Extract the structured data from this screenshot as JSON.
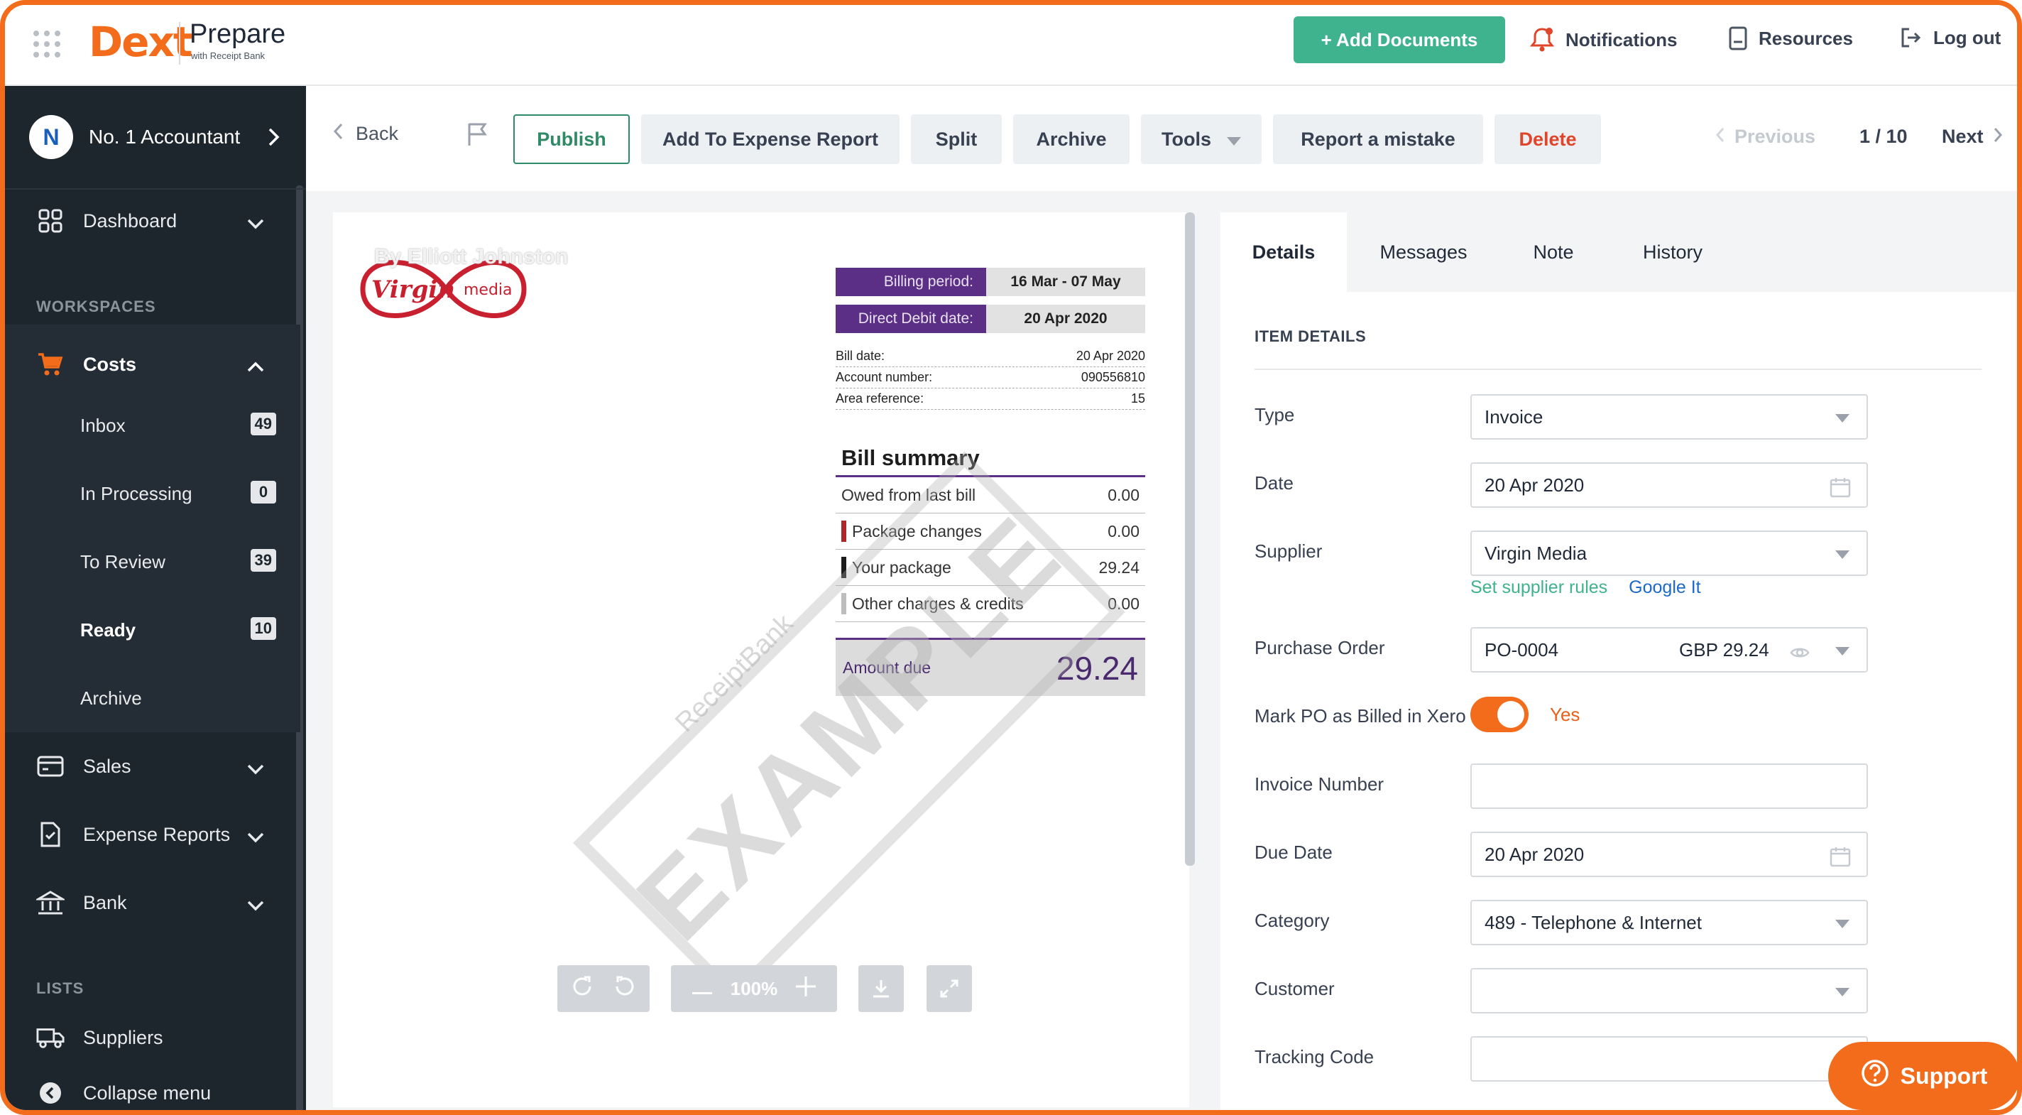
{
  "app": {
    "logo": "Dext",
    "product": "Prepare",
    "product_sub": "with Receipt Bank"
  },
  "topnav": {
    "add_documents": "+ Add Documents",
    "notifications": "Notifications",
    "resources": "Resources",
    "logout": "Log out"
  },
  "sidebar": {
    "account": {
      "initial": "N",
      "name": "No. 1 Accountant"
    },
    "dashboard": "Dashboard",
    "workspaces_heading": "WORKSPACES",
    "costs": "Costs",
    "costs_items": [
      {
        "label": "Inbox",
        "count": "49"
      },
      {
        "label": "In Processing",
        "count": "0"
      },
      {
        "label": "To Review",
        "count": "39"
      },
      {
        "label": "Ready",
        "count": "10"
      },
      {
        "label": "Archive",
        "count": ""
      }
    ],
    "sales": "Sales",
    "expense_reports": "Expense Reports",
    "bank": "Bank",
    "lists_heading": "LISTS",
    "suppliers": "Suppliers",
    "collapse": "Collapse menu"
  },
  "toolbar": {
    "back": "Back",
    "publish": "Publish",
    "add_to_expense": "Add To Expense Report",
    "split": "Split",
    "archive": "Archive",
    "tools": "Tools",
    "report_mistake": "Report a mistake",
    "delete": "Delete",
    "previous": "Previous",
    "page": "1 / 10",
    "next": "Next"
  },
  "document": {
    "uploader": "By Elliott Johnston",
    "brand": "Virgin media",
    "billing_period_label": "Billing period:",
    "billing_period": "16 Mar - 07 May",
    "dd_label": "Direct Debit date:",
    "dd_date": "20 Apr 2020",
    "info": [
      {
        "label": "Bill date:",
        "value": "20 Apr 2020"
      },
      {
        "label": "Account number:",
        "value": "090556810"
      },
      {
        "label": "Area reference:",
        "value": "15"
      }
    ],
    "summary_title": "Bill summary",
    "summary": [
      {
        "label": "Owed from last bill",
        "value": "0.00",
        "marker": ""
      },
      {
        "label": "Package changes",
        "value": "0.00",
        "marker": "#b0242c"
      },
      {
        "label": "Your package",
        "value": "29.24",
        "marker": "#1d1d1d"
      },
      {
        "label": "Other charges & credits",
        "value": "0.00",
        "marker": "#bdbdbd"
      }
    ],
    "amount_label": "Amount due",
    "amount": "29.24",
    "watermark": "EXAMPLE",
    "watermark_sub": "ReceiptBank",
    "zoom": "100%"
  },
  "details": {
    "tabs": [
      "Details",
      "Messages",
      "Note",
      "History"
    ],
    "section": "ITEM DETAILS",
    "fields": {
      "type": {
        "label": "Type",
        "value": "Invoice"
      },
      "date": {
        "label": "Date",
        "value": "20 Apr 2020"
      },
      "supplier": {
        "label": "Supplier",
        "value": "Virgin Media"
      },
      "supplier_rules": "Set supplier rules",
      "google_it": "Google It",
      "po": {
        "label": "Purchase Order",
        "value": "PO-0004",
        "amount": "GBP 29.24"
      },
      "mark_po": {
        "label": "Mark PO as Billed in Xero",
        "value": "Yes"
      },
      "invoice_number": {
        "label": "Invoice Number",
        "value": ""
      },
      "due_date": {
        "label": "Due Date",
        "value": "20 Apr 2020"
      },
      "category": {
        "label": "Category",
        "value": "489 - Telephone & Internet"
      },
      "customer": {
        "label": "Customer",
        "value": ""
      },
      "tracking": {
        "label": "Tracking Code",
        "value": ""
      }
    }
  },
  "support": "Support",
  "colors": {
    "brand_orange": "#f26c1c",
    "add_green": "#3fb28e",
    "sidebar": "#1d252d",
    "virgin_purple": "#5c2f86"
  }
}
